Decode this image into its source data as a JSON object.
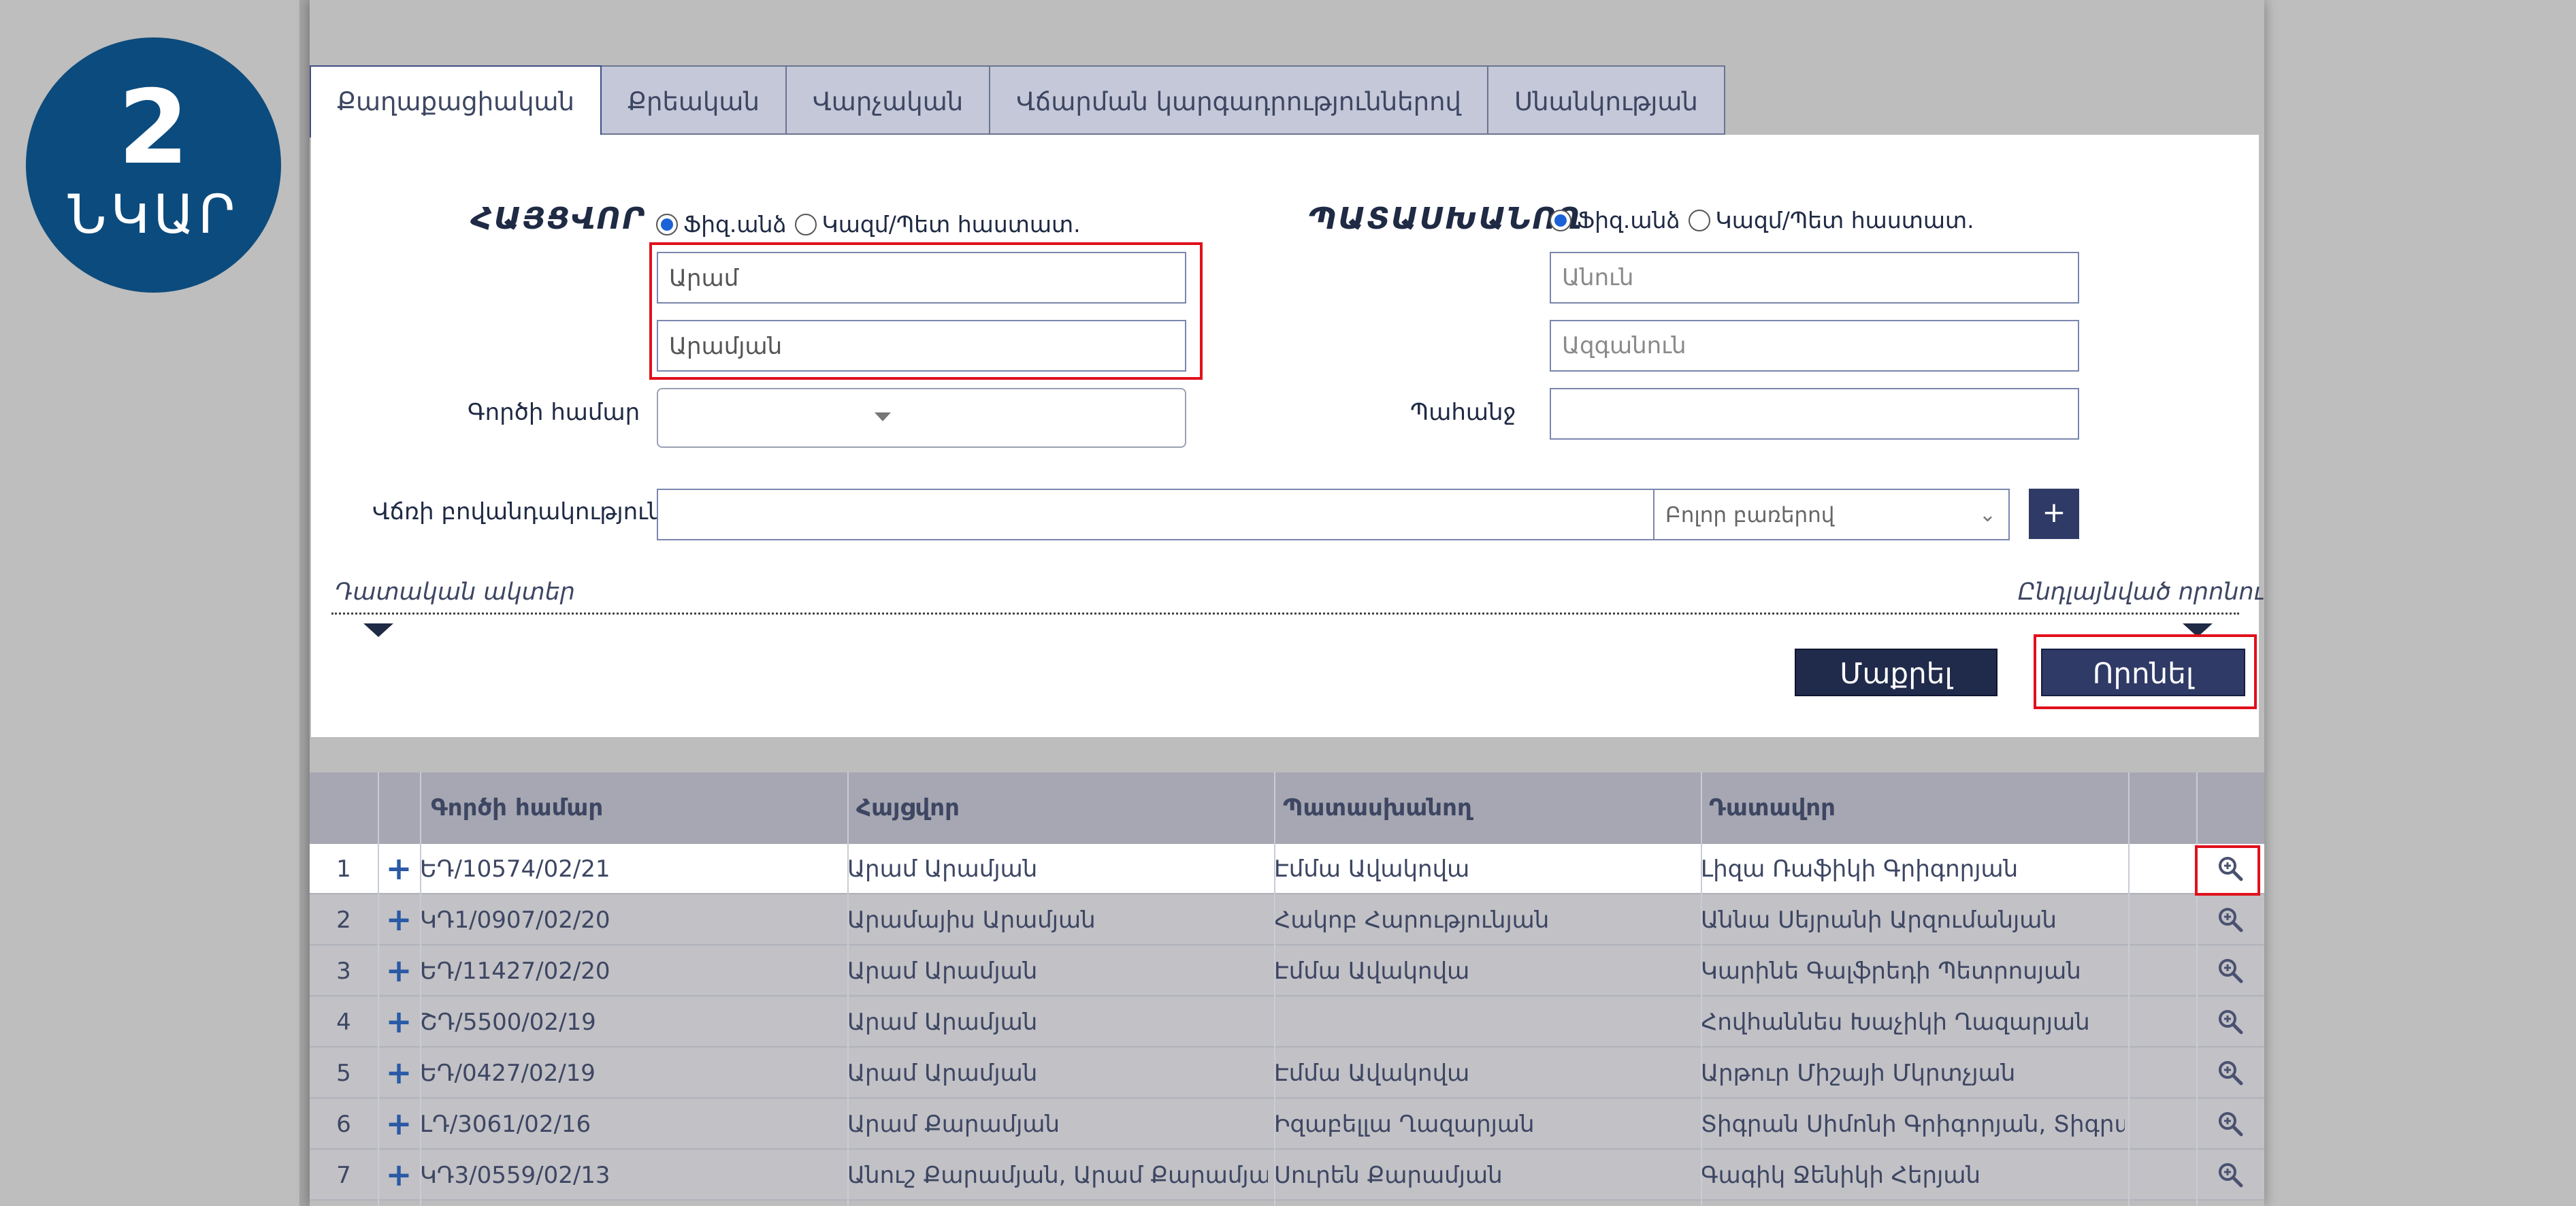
{
  "badge": {
    "number": "2",
    "word": "ՆԿԱՐ"
  },
  "tabs": [
    {
      "label": "Քաղաքացիական",
      "active": true
    },
    {
      "label": "Քրեական",
      "active": false
    },
    {
      "label": "Վարչական",
      "active": false
    },
    {
      "label": "Վճարման կարգադրություններով",
      "active": false
    },
    {
      "label": "Սնանկության",
      "active": false
    }
  ],
  "plaintiff": {
    "title": "ՀԱՅՑՎՈՐ",
    "radio_physical": "Ֆիզ.անձ",
    "radio_org": "Կազմ/Պետ հաստատ.",
    "first_name_value": "Արամ",
    "last_name_value": "Արամյան"
  },
  "defendant": {
    "title": "ՊԱՏԱՍԽԱՆՈՂ",
    "radio_physical": "Ֆիզ.անձ",
    "radio_org": "Կազմ/Պետ հաստատ.",
    "first_name_placeholder": "Անուն",
    "last_name_placeholder": "Ազգանուն"
  },
  "case_number_label": "Գործի համար",
  "claim_label": "Պահանջ",
  "verdict_content_label": "Վճռի բովանդակություն",
  "word_mode_select": "Բոլոր բառերով",
  "add_button": "+",
  "additional_data_link": "Դատական ակտեր",
  "advanced_search_link": "Ընդլայնված որոնում",
  "clear_button": "Մաքրել",
  "search_button": "Որոնել",
  "table": {
    "headers": [
      "Գործի համար",
      "Հայցվոր",
      "Պատասխանող",
      "Դատավոր"
    ],
    "rows": [
      {
        "n": "1",
        "case": "ԵԴ/10574/02/21",
        "plaintiff": "Արամ Արամյան",
        "defendant": "Էմմա Ավակովա",
        "judge": "Լիզա Ռաֆիկի Գրիգորյան"
      },
      {
        "n": "2",
        "case": "ԿԴ1/0907/02/20",
        "plaintiff": "Արամայիս Արամյան",
        "defendant": "Հակոբ Հարությունյան",
        "judge": "Աննա Սեյրանի Արզումանյան"
      },
      {
        "n": "3",
        "case": "ԵԴ/11427/02/20",
        "plaintiff": "Արամ Արամյան",
        "defendant": "Էմմա Ավակովա",
        "judge": "Կարինե Գալֆրեդի Պետրոսյան"
      },
      {
        "n": "4",
        "case": "ՇԴ/5500/02/19",
        "plaintiff": "Արամ Արամյան",
        "defendant": "",
        "judge": "Հովհաննես Խաչիկի Ղազարյան"
      },
      {
        "n": "5",
        "case": "ԵԴ/0427/02/19",
        "plaintiff": "Արամ Արամյան",
        "defendant": "Էմմա Ավակովա",
        "judge": "Արթուր Միշայի Մկրտչյան"
      },
      {
        "n": "6",
        "case": "ԼԴ/3061/02/16",
        "plaintiff": "Արամ Քարամյան",
        "defendant": "Իզաբելլա Ղազարյան",
        "judge": "Տիգրան Սիմոնի Գրիգորյան, Տիգրան Սի"
      },
      {
        "n": "7",
        "case": "ԿԴ3/0559/02/13",
        "plaintiff": "Անուշ Քարամյան, Արամ Քարամյան, Անի",
        "defendant": "Սուրեն Քարամյան",
        "judge": "Գագիկ Ջենիկի Հերյան"
      }
    ]
  }
}
